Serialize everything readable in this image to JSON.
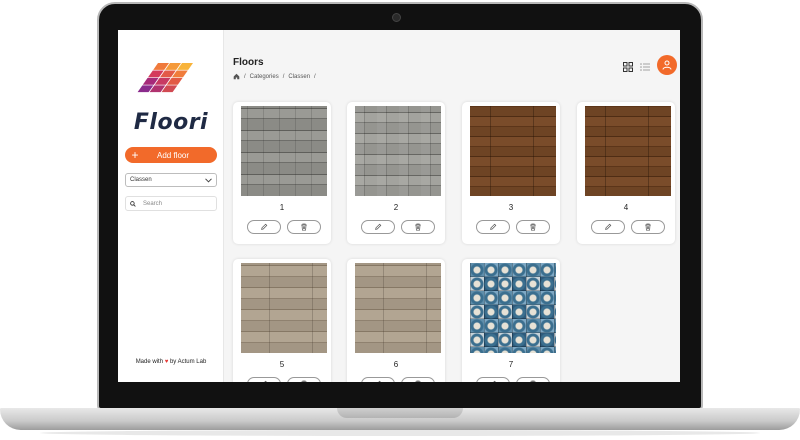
{
  "colors": {
    "accent": "#f26a2a",
    "brand_text": "#1f2a44",
    "heart": "#e53935"
  },
  "sidebar": {
    "brand": "Floori",
    "add_button": "Add floor",
    "select_value": "Classen",
    "search_placeholder": "Search",
    "footer_prefix": "Made with",
    "footer_suffix": "by Actum Lab"
  },
  "header": {
    "title": "Floors",
    "breadcrumb": [
      "/",
      "Categories",
      "/",
      "Classen",
      "/"
    ]
  },
  "floors": [
    {
      "label": "1",
      "texture": "gray weathered wood"
    },
    {
      "label": "2",
      "texture": "gray weathered wood"
    },
    {
      "label": "3",
      "texture": "dark brown wood"
    },
    {
      "label": "4",
      "texture": "dark brown wood"
    },
    {
      "label": "5",
      "texture": "light oak wood"
    },
    {
      "label": "6",
      "texture": "light oak wood"
    },
    {
      "label": "7",
      "texture": "blue patterned tiles"
    }
  ]
}
